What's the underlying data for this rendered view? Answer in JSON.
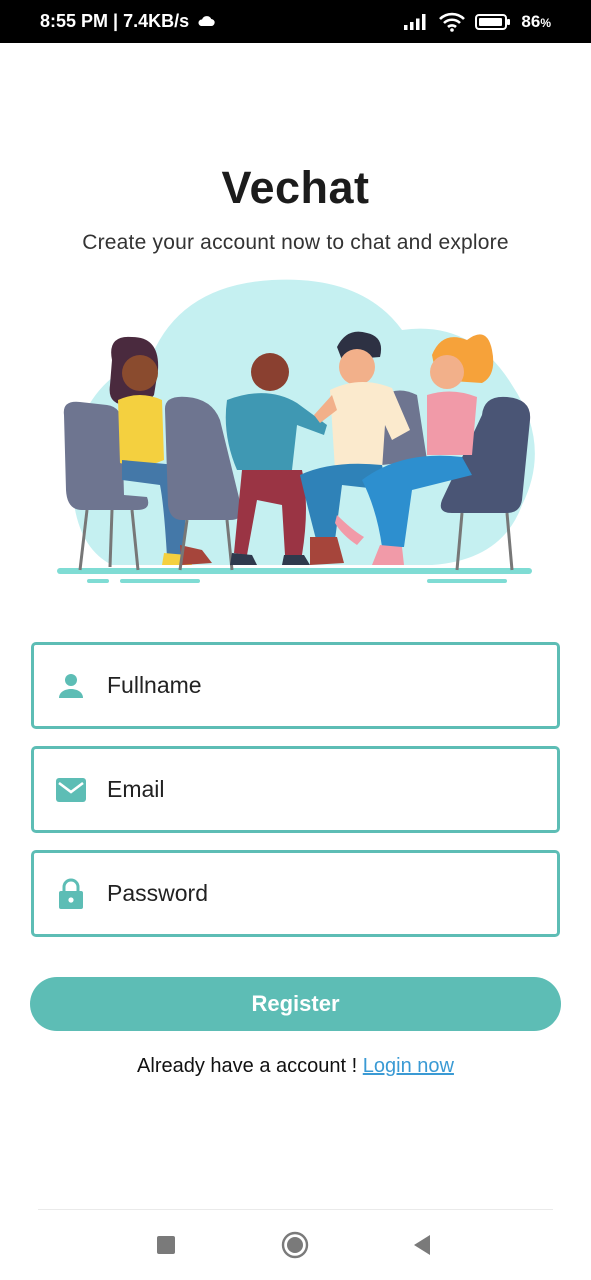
{
  "status_bar": {
    "time_speed": "8:55 PM | 7.4KB/s",
    "battery": "86",
    "battery_unit": "%",
    "icons": [
      "cloud-icon",
      "signal-icon",
      "wifi-icon",
      "battery-icon"
    ]
  },
  "app": {
    "title": "Vechat",
    "subtitle": "Create your account now to chat and explore"
  },
  "form": {
    "fullname_label": "Fullname",
    "email_label": "Email",
    "password_label": "Password",
    "register_label": "Register"
  },
  "login": {
    "prompt": "Already have a account ! ",
    "link": "Login now"
  },
  "nav": {
    "icons": [
      "recents-square-icon",
      "home-circle-icon",
      "back-triangle-icon"
    ]
  },
  "colors": {
    "accent": "#5dbdb5",
    "link": "#3a9ad4",
    "illustration_bg": "#c5f0f1"
  }
}
